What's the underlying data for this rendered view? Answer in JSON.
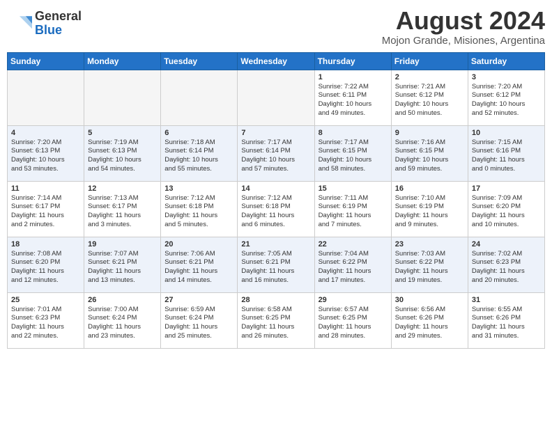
{
  "header": {
    "logo_general": "General",
    "logo_blue": "Blue",
    "month_year": "August 2024",
    "location": "Mojon Grande, Misiones, Argentina"
  },
  "weekdays": [
    "Sunday",
    "Monday",
    "Tuesday",
    "Wednesday",
    "Thursday",
    "Friday",
    "Saturday"
  ],
  "weeks": [
    [
      {
        "day": "",
        "info": ""
      },
      {
        "day": "",
        "info": ""
      },
      {
        "day": "",
        "info": ""
      },
      {
        "day": "",
        "info": ""
      },
      {
        "day": "1",
        "info": "Sunrise: 7:22 AM\nSunset: 6:11 PM\nDaylight: 10 hours\nand 49 minutes."
      },
      {
        "day": "2",
        "info": "Sunrise: 7:21 AM\nSunset: 6:12 PM\nDaylight: 10 hours\nand 50 minutes."
      },
      {
        "day": "3",
        "info": "Sunrise: 7:20 AM\nSunset: 6:12 PM\nDaylight: 10 hours\nand 52 minutes."
      }
    ],
    [
      {
        "day": "4",
        "info": "Sunrise: 7:20 AM\nSunset: 6:13 PM\nDaylight: 10 hours\nand 53 minutes."
      },
      {
        "day": "5",
        "info": "Sunrise: 7:19 AM\nSunset: 6:13 PM\nDaylight: 10 hours\nand 54 minutes."
      },
      {
        "day": "6",
        "info": "Sunrise: 7:18 AM\nSunset: 6:14 PM\nDaylight: 10 hours\nand 55 minutes."
      },
      {
        "day": "7",
        "info": "Sunrise: 7:17 AM\nSunset: 6:14 PM\nDaylight: 10 hours\nand 57 minutes."
      },
      {
        "day": "8",
        "info": "Sunrise: 7:17 AM\nSunset: 6:15 PM\nDaylight: 10 hours\nand 58 minutes."
      },
      {
        "day": "9",
        "info": "Sunrise: 7:16 AM\nSunset: 6:15 PM\nDaylight: 10 hours\nand 59 minutes."
      },
      {
        "day": "10",
        "info": "Sunrise: 7:15 AM\nSunset: 6:16 PM\nDaylight: 11 hours\nand 0 minutes."
      }
    ],
    [
      {
        "day": "11",
        "info": "Sunrise: 7:14 AM\nSunset: 6:17 PM\nDaylight: 11 hours\nand 2 minutes."
      },
      {
        "day": "12",
        "info": "Sunrise: 7:13 AM\nSunset: 6:17 PM\nDaylight: 11 hours\nand 3 minutes."
      },
      {
        "day": "13",
        "info": "Sunrise: 7:12 AM\nSunset: 6:18 PM\nDaylight: 11 hours\nand 5 minutes."
      },
      {
        "day": "14",
        "info": "Sunrise: 7:12 AM\nSunset: 6:18 PM\nDaylight: 11 hours\nand 6 minutes."
      },
      {
        "day": "15",
        "info": "Sunrise: 7:11 AM\nSunset: 6:19 PM\nDaylight: 11 hours\nand 7 minutes."
      },
      {
        "day": "16",
        "info": "Sunrise: 7:10 AM\nSunset: 6:19 PM\nDaylight: 11 hours\nand 9 minutes."
      },
      {
        "day": "17",
        "info": "Sunrise: 7:09 AM\nSunset: 6:20 PM\nDaylight: 11 hours\nand 10 minutes."
      }
    ],
    [
      {
        "day": "18",
        "info": "Sunrise: 7:08 AM\nSunset: 6:20 PM\nDaylight: 11 hours\nand 12 minutes."
      },
      {
        "day": "19",
        "info": "Sunrise: 7:07 AM\nSunset: 6:21 PM\nDaylight: 11 hours\nand 13 minutes."
      },
      {
        "day": "20",
        "info": "Sunrise: 7:06 AM\nSunset: 6:21 PM\nDaylight: 11 hours\nand 14 minutes."
      },
      {
        "day": "21",
        "info": "Sunrise: 7:05 AM\nSunset: 6:21 PM\nDaylight: 11 hours\nand 16 minutes."
      },
      {
        "day": "22",
        "info": "Sunrise: 7:04 AM\nSunset: 6:22 PM\nDaylight: 11 hours\nand 17 minutes."
      },
      {
        "day": "23",
        "info": "Sunrise: 7:03 AM\nSunset: 6:22 PM\nDaylight: 11 hours\nand 19 minutes."
      },
      {
        "day": "24",
        "info": "Sunrise: 7:02 AM\nSunset: 6:23 PM\nDaylight: 11 hours\nand 20 minutes."
      }
    ],
    [
      {
        "day": "25",
        "info": "Sunrise: 7:01 AM\nSunset: 6:23 PM\nDaylight: 11 hours\nand 22 minutes."
      },
      {
        "day": "26",
        "info": "Sunrise: 7:00 AM\nSunset: 6:24 PM\nDaylight: 11 hours\nand 23 minutes."
      },
      {
        "day": "27",
        "info": "Sunrise: 6:59 AM\nSunset: 6:24 PM\nDaylight: 11 hours\nand 25 minutes."
      },
      {
        "day": "28",
        "info": "Sunrise: 6:58 AM\nSunset: 6:25 PM\nDaylight: 11 hours\nand 26 minutes."
      },
      {
        "day": "29",
        "info": "Sunrise: 6:57 AM\nSunset: 6:25 PM\nDaylight: 11 hours\nand 28 minutes."
      },
      {
        "day": "30",
        "info": "Sunrise: 6:56 AM\nSunset: 6:26 PM\nDaylight: 11 hours\nand 29 minutes."
      },
      {
        "day": "31",
        "info": "Sunrise: 6:55 AM\nSunset: 6:26 PM\nDaylight: 11 hours\nand 31 minutes."
      }
    ]
  ]
}
